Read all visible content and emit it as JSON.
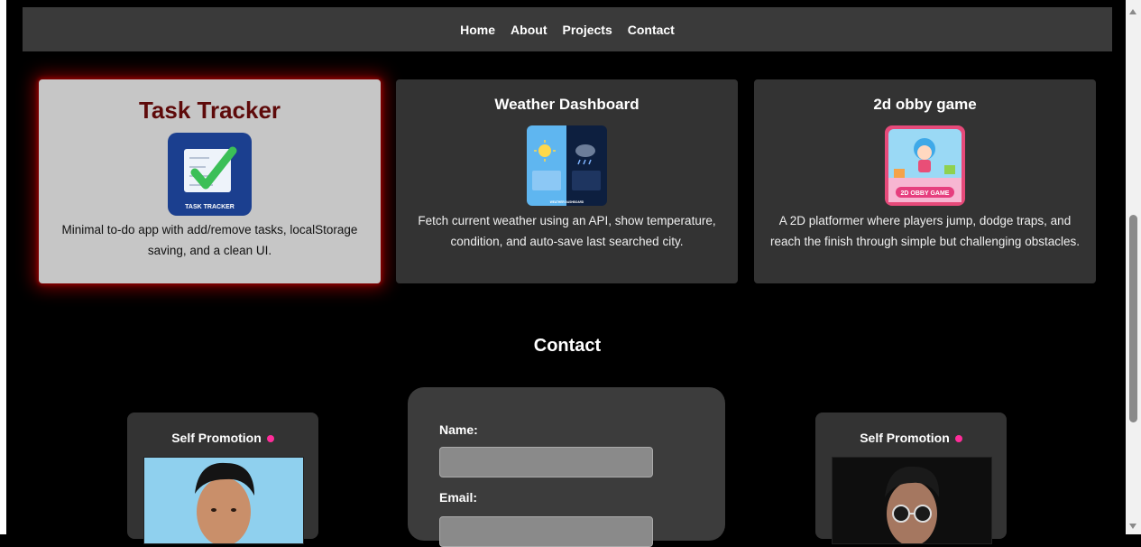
{
  "nav": {
    "links": [
      "Home",
      "About",
      "Projects",
      "Contact"
    ]
  },
  "projects": [
    {
      "title": "Task Tracker",
      "thumb_caption": "TASK TRACKER",
      "description": "Minimal to-do app with add/remove tasks, localStorage saving, and a clean UI.",
      "icon": "checkmark-icon"
    },
    {
      "title": "Weather Dashboard",
      "thumb_caption": "WEATHER DASHBOARD",
      "description": "Fetch current weather using an API, show temperature, condition, and auto-save last searched city.",
      "icon": "weather-icon"
    },
    {
      "title": "2d obby game",
      "thumb_caption": "2D OBBY GAME",
      "description": "A 2D platformer where players jump, dodge traps, and reach the finish through simple but challenging obstacles.",
      "icon": "game-icon"
    }
  ],
  "contact": {
    "title": "Contact",
    "name_label": "Name:",
    "email_label": "Email:",
    "name_value": "",
    "email_value": ""
  },
  "promo": {
    "left_title": "Self Promotion",
    "right_title": "Self Promotion"
  },
  "colors": {
    "background": "#000000",
    "card": "#333333",
    "highlight_card": "#c6c6c6",
    "highlight_title": "#5e0a0a",
    "glow": "#c80000",
    "input": "#8a8a8a"
  }
}
